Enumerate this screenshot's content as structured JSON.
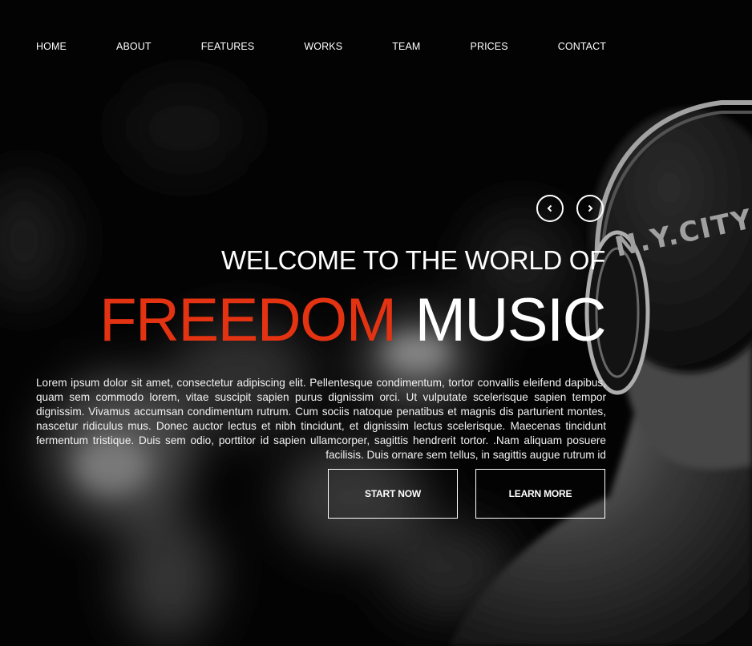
{
  "nav": {
    "items": [
      {
        "label": "HOME"
      },
      {
        "label": "ABOUT"
      },
      {
        "label": "FEATURES"
      },
      {
        "label": "WORKS"
      },
      {
        "label": "TEAM"
      },
      {
        "label": "PRICES"
      },
      {
        "label": "CONTACT"
      }
    ]
  },
  "slider": {
    "prev_icon": "chevron-left-icon",
    "next_icon": "chevron-right-icon"
  },
  "hero": {
    "welcome": "WELCOME TO THE WORLD OF",
    "headline_accent": "FREEDOM",
    "headline_rest": "MUSIC",
    "body": "Lorem ipsum dolor sit amet, consectetur adipiscing elit. Pellentesque condimentum, tortor convallis eleifend dapibus, quam sem commodo lorem, vitae suscipit sapien purus dignissim orci. Ut vulputate scelerisque sapien tempor dignissim. Vivamus accumsan condimentum rutrum. Cum sociis natoque penatibus et magnis dis parturient montes, nascetur ridiculus mus. Donec auctor lectus et nibh tincidunt, et dignissim lectus scelerisque. Maecenas tincidunt fermentum tristique. Duis sem odio, porttitor id sapien ullamcorper, sagittis hendrerit tortor. .Nam aliquam posuere facilisis. Duis ornare sem tellus, in sagittis augue rutrum id",
    "start_label": "START NOW",
    "learn_label": "LEARN MORE",
    "cap_text": "N.Y.CITY"
  },
  "colors": {
    "accent": "#e43312",
    "background": "#050505",
    "text": "#ffffff"
  }
}
